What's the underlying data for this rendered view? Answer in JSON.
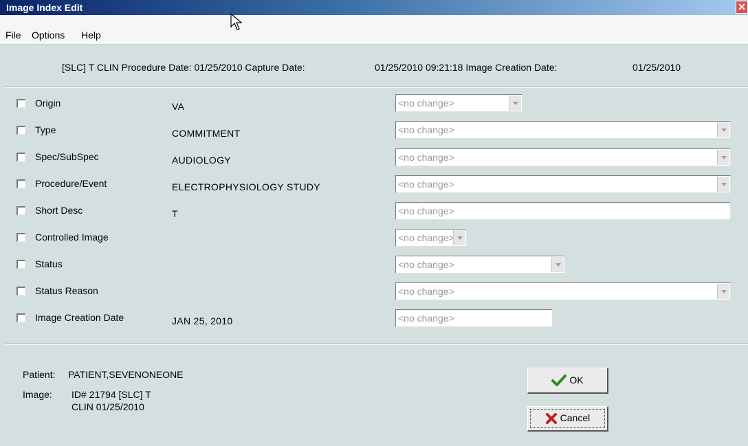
{
  "window": {
    "title": "Image Index Edit",
    "close_glyph": "✕"
  },
  "menu": [
    "File",
    "Options",
    "Help"
  ],
  "header": {
    "part1": "[SLC] T CLIN Procedure Date: 01/25/2010 Capture Date:",
    "part2": "01/25/2010 09:21:18 Image Creation Date:",
    "part3": "01/25/2010"
  },
  "fields": {
    "origin": {
      "label": "Origin",
      "value": "VA",
      "control": "<no change>",
      "checked": false
    },
    "type": {
      "label": "Type",
      "value": "COMMITMENT",
      "control": "<no change>",
      "checked": false
    },
    "spec": {
      "label": "Spec/SubSpec",
      "value": "AUDIOLOGY",
      "control": "<no change>",
      "checked": false
    },
    "procedure": {
      "label": "Procedure/Event",
      "value": "ELECTROPHYSIOLOGY STUDY",
      "control": "<no change>",
      "checked": false
    },
    "short_desc": {
      "label": "Short Desc",
      "value": "T",
      "control": "<no change>",
      "checked": false
    },
    "controlled": {
      "label": "Controlled Image",
      "value": "",
      "control": "<no change>",
      "checked": false
    },
    "status": {
      "label": "Status",
      "value": "",
      "control": "<no change>",
      "checked": false
    },
    "status_reason": {
      "label": "Status Reason",
      "value": "",
      "control": "<no change>",
      "checked": false
    },
    "creation_date": {
      "label": "Image Creation Date",
      "value": "JAN 25, 2010",
      "control": "<no change>",
      "checked": false
    }
  },
  "footer": {
    "patient_label": "Patient:",
    "patient_value": "PATIENT,SEVENONEONE",
    "image_label": "Image:",
    "image_line1": "ID# 21794 [SLC] T",
    "image_line2": "CLIN 01/25/2010"
  },
  "buttons": {
    "ok": "OK",
    "cancel": "Cancel"
  },
  "icons": {
    "ok": "checkmark-icon",
    "cancel": "x-icon",
    "close": "close-icon",
    "cursor": "mouse-cursor-icon"
  },
  "colors": {
    "titlebar_start": "#0a246a",
    "titlebar_end": "#a6caf0",
    "background": "#d4e0e0",
    "ok_check": "#2e8b1e",
    "cancel_x": "#c0201a"
  }
}
